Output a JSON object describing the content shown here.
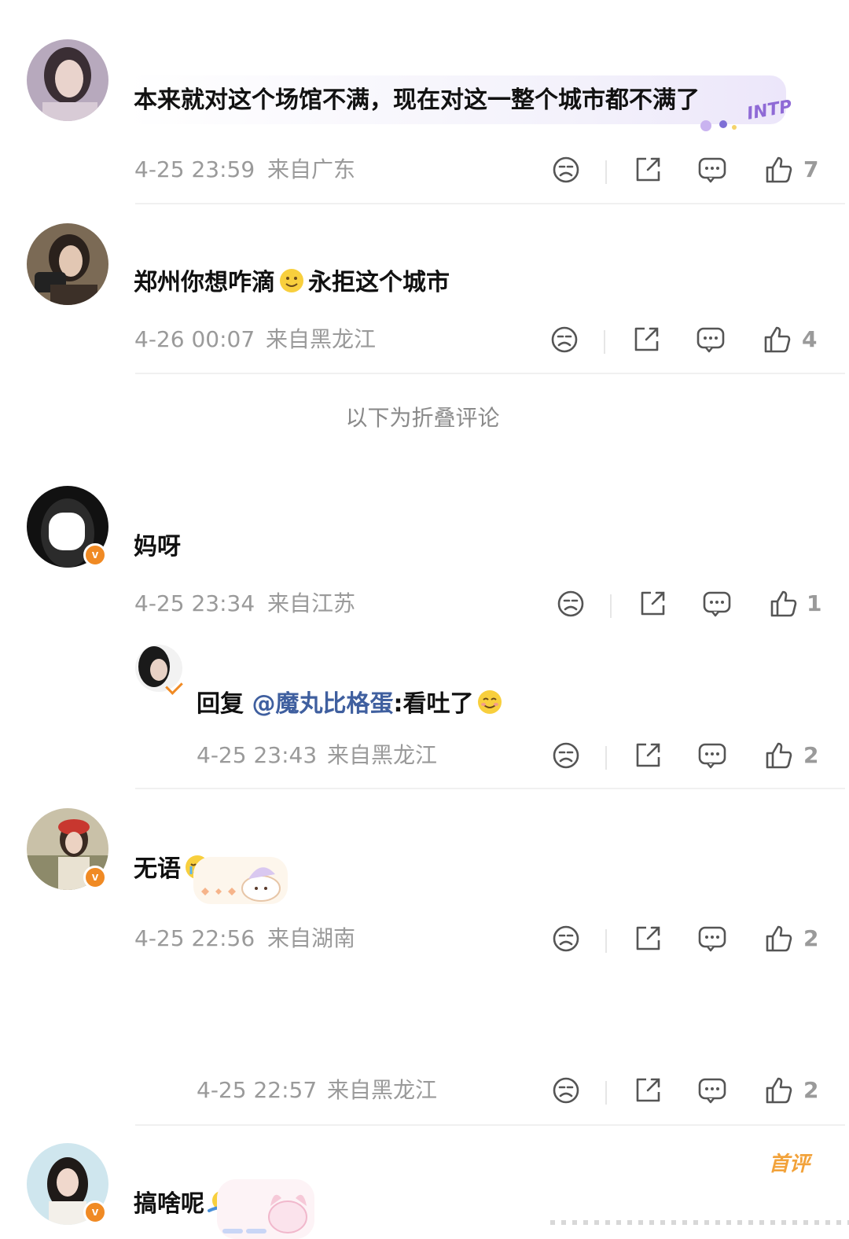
{
  "comments": [
    {
      "text": "本来就对这个场馆不满，现在对这一整个城市都不满了",
      "badge_text": "INTP",
      "time": "4-25 23:59",
      "location": "来自广东",
      "likes": "7"
    },
    {
      "text_before": "郑州你想咋滴",
      "text_after": "永拒这个城市",
      "time": "4-26 00:07",
      "location": "来自黑龙江",
      "likes": "4"
    }
  ],
  "folded_notice": "以下为折叠评论",
  "folded_comments": [
    {
      "text": "妈呀",
      "time": "4-25 23:34",
      "location": "来自江苏",
      "likes": "1",
      "reply": {
        "prefix": "回复",
        "mention": "@魔丸比格蛋",
        "body": ":看吐了",
        "time": "4-25 23:43",
        "location": "来自黑龙江",
        "likes": "2"
      }
    },
    {
      "text": "无语",
      "time": "4-25 22:56",
      "location": "来自湖南",
      "likes": "2",
      "sub": {
        "time": "4-25 22:57",
        "location": "来自黑龙江",
        "likes": "2"
      }
    },
    {
      "text": "搞啥呢",
      "first_badge": "首评"
    }
  ],
  "verified_mark": "v",
  "icons": [
    "dislike-icon",
    "share-icon",
    "comment-icon",
    "like-icon"
  ],
  "colors": {
    "meta": "#9a9a9a",
    "mention": "#3f5f9f",
    "badge": "#f08a24",
    "first": "#f2a23a"
  }
}
